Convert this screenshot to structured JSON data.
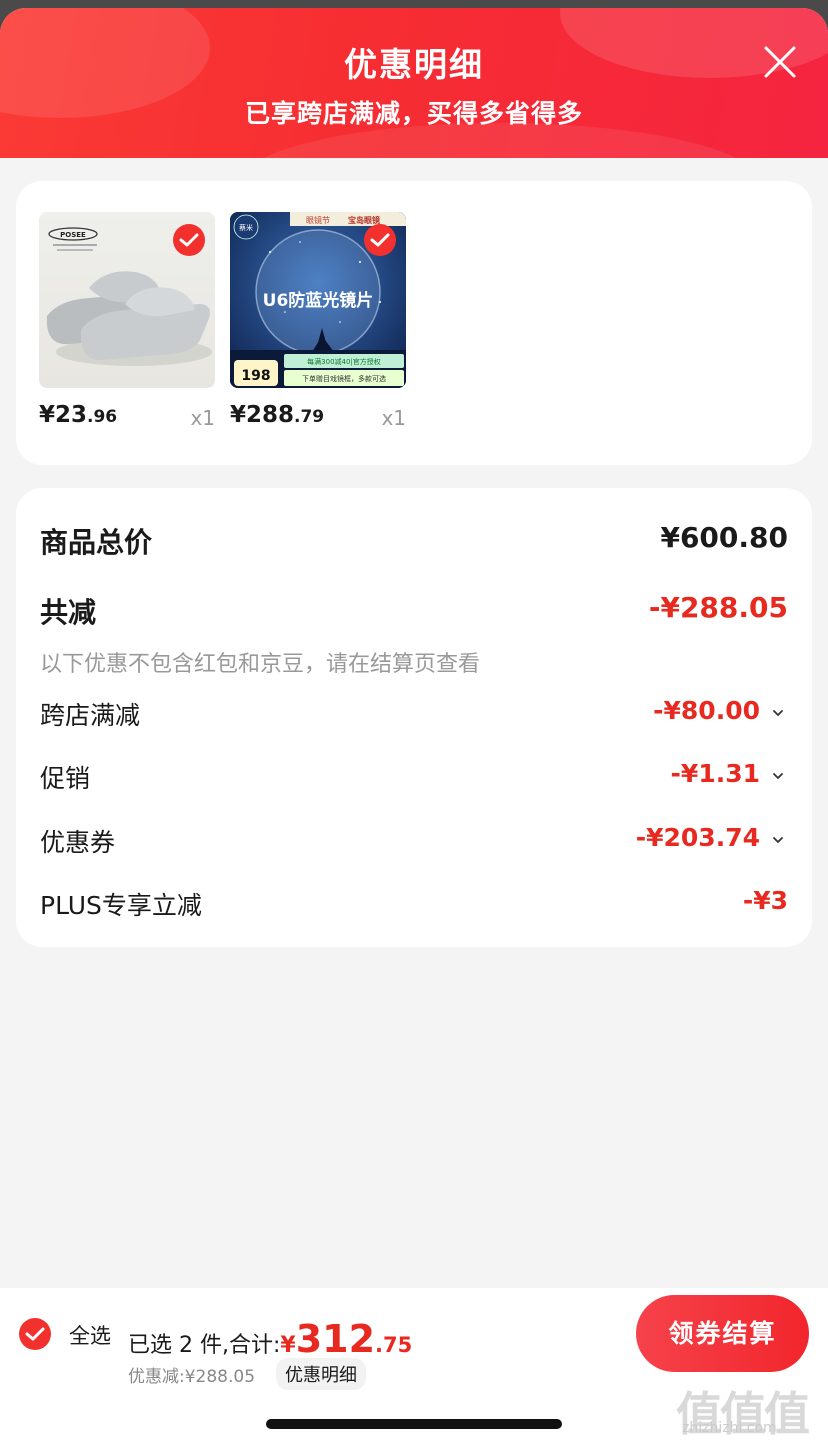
{
  "header": {
    "title": "优惠明细",
    "subtitle": "已享跨店满减，买得多省得多"
  },
  "products": [
    {
      "name": "slippers",
      "brand_text": "POSEE",
      "price_int": "¥23",
      "price_dec": ".96",
      "qty": "x1",
      "selected": true
    },
    {
      "name": "blue-light-lens",
      "brand_text": "蔡米",
      "promo_top_left": "眼镜节",
      "promo_top_right": "宝岛眼镜",
      "image_title": "U6防蓝光镜片",
      "promo_price": "198",
      "promo_line1": "每满300减40|官方授权",
      "promo_line2": "下单赠目戏镜框，多款可选",
      "price_int": "¥288",
      "price_dec": ".79",
      "qty": "x1",
      "selected": true
    }
  ],
  "summary": {
    "total_label": "商品总价",
    "total_value": "¥600.80",
    "reduce_label": "共减",
    "reduce_value": "-¥288.05",
    "note": "以下优惠不包含红包和京豆，请在结算页查看",
    "items": [
      {
        "label": "跨店满减",
        "value": "-¥80.00",
        "expandable": true
      },
      {
        "label": "促销",
        "value": "-¥1.31",
        "expandable": true
      },
      {
        "label": "优惠券",
        "value": "-¥203.74",
        "expandable": true
      },
      {
        "label": "PLUS专享立减",
        "value": "-¥3",
        "expandable": false
      }
    ]
  },
  "bottom": {
    "select_all": "全选",
    "selected_prefix": "已选 2 件,合计:",
    "total_yen": "¥",
    "total_int": "312",
    "total_dec": ".75",
    "discount": "优惠减:¥288.05",
    "detail_link": "优惠明细",
    "checkout": "领券结算"
  },
  "watermark": {
    "glyphs": "值值值",
    "url": "zhizhizhi.com"
  },
  "colors": {
    "accent": "#f2312f",
    "price_red": "#e8291f",
    "header_red": "#f62d32"
  }
}
